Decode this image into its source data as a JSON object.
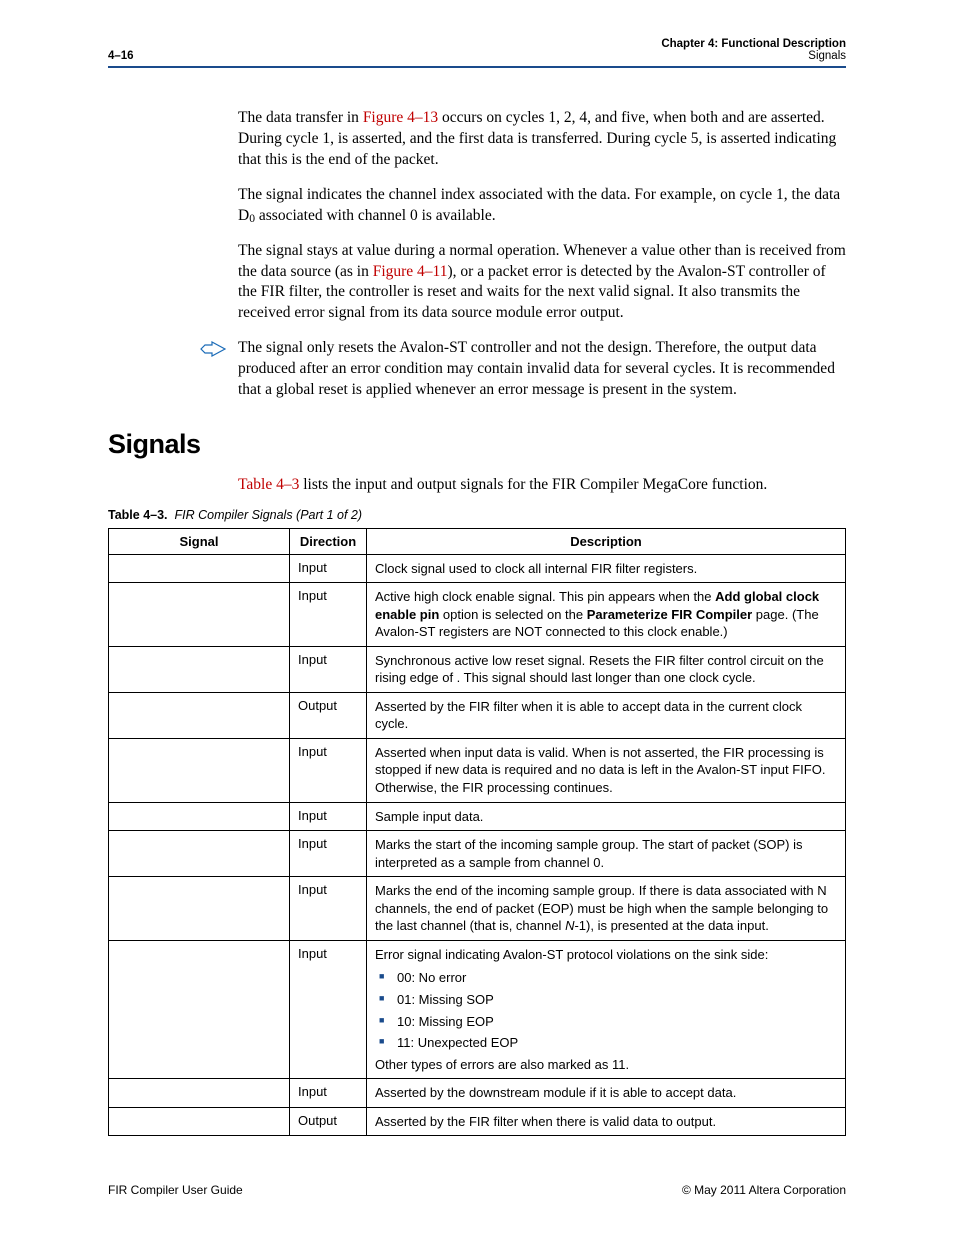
{
  "header": {
    "page_num": "4–16",
    "chapter_line": "Chapter 4:  Functional Description",
    "section_line": "Signals"
  },
  "paras": {
    "p1a": "The data transfer in ",
    "p1_figref": "Figure 4–13",
    "p1b": " occurs on cycles 1, 2, 4, and five, when both         and         are asserted. During cycle 1,                              is asserted, and the first data is transferred. During cycle 5,                              is asserted indicating that this is the end of the packet.",
    "p2": "The                 signal indicates the channel index associated with the data. For example, on cycle 1, the data D",
    "p2b": " associated with channel 0 is available.",
    "p3a": "The             signal stays at value        during a normal operation. Whenever a value other than       is received from the data source (as in ",
    "p3_figref": "Figure 4–11",
    "p3b": "), or a packet error is detected by the Avalon-ST controller of the FIR filter, the controller is reset and waits for the next valid                                   signal. It also transmits the received error signal from its data source module error output.",
    "note": "The             signal only resets the Avalon-ST controller and not the design. Therefore, the output data produced after an error condition may contain invalid data for several cycles. It is recommended that a global reset is applied whenever an error message is present in the system."
  },
  "heading": "Signals",
  "intro_a": "Table 4–3",
  "intro_b": " lists the input and output signals for the FIR Compiler MegaCore function.",
  "caption_bold": "Table 4–3.",
  "caption_italic": "FIR Compiler Signals  (Part 1 of 2)",
  "columns": {
    "c1": "Signal",
    "c2": "Direction",
    "c3": "Description"
  },
  "rows": [
    {
      "signal": "",
      "dir": "Input",
      "desc": "Clock signal used to clock all internal FIR filter registers."
    },
    {
      "signal": "",
      "dir": "Input",
      "desc_html": "Active high clock enable signal. This pin appears when the <b>Add global clock enable pin</b> option is selected on the <b>Parameterize FIR Compiler</b> page. (The Avalon-ST registers are NOT connected to this clock enable.)"
    },
    {
      "signal": "",
      "dir": "Input",
      "desc": "Synchronous active low reset signal. Resets the FIR filter control circuit on the rising edge of          . This signal should last longer than one clock cycle."
    },
    {
      "signal": "",
      "dir": "Output",
      "desc": "Asserted by the FIR filter when it is able to accept data in the current clock cycle."
    },
    {
      "signal": "",
      "dir": "Input",
      "desc": "Asserted when input data is valid. When                                              is not asserted, the FIR processing is stopped if new data is required and no data is left in the Avalon-ST input FIFO. Otherwise, the FIR processing continues."
    },
    {
      "signal": "",
      "dir": "Input",
      "desc": "Sample input data."
    },
    {
      "signal": "",
      "dir": "Input",
      "desc": "Marks the start of the incoming sample group. The start of packet (SOP) is interpreted as a sample from channel 0."
    },
    {
      "signal": "",
      "dir": "Input",
      "desc_html": "Marks the end of the incoming sample group. If there is data associated with N channels, the end of packet (EOP) must be high when the sample belonging to the last channel (that is, channel <i>N</i>-1), is presented at the data input."
    },
    {
      "signal": "",
      "dir": "Input",
      "desc": "Error signal indicating Avalon-ST protocol violations on the sink side:",
      "bullets": [
        "00: No error",
        "01: Missing SOP",
        "10: Missing EOP",
        "11: Unexpected EOP"
      ],
      "after": "Other types of errors are also marked as 11."
    },
    {
      "signal": "",
      "dir": "Input",
      "desc": "Asserted by the downstream module if it is able to accept data."
    },
    {
      "signal": "",
      "dir": "Output",
      "desc": "Asserted by the FIR filter when there is valid data to output."
    }
  ],
  "footer": {
    "left": "FIR Compiler User Guide",
    "right": "© May 2011   Altera Corporation"
  }
}
